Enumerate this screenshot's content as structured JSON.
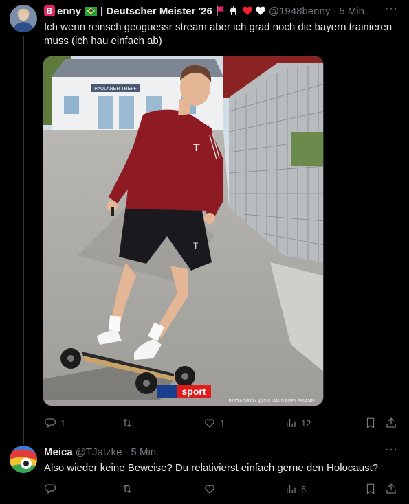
{
  "tweet1": {
    "author_name": "enny",
    "badge_letter": "B",
    "name_suffix": " | Deutscher Meister '26",
    "handle": "@1948benny",
    "time": "5 Min.",
    "text": "Ich wenn reinsch geoguessr stream aber ich grad noch die bayern trainieren muss (ich hau einfach ab)",
    "image_credit": "INSTAGRAM @JULIAN.NAGELSMANN",
    "broadcaster_logo": "sport",
    "jersey_logo": "T",
    "sign_text": "PAULANER TREFF",
    "stats": {
      "replies": "1",
      "retweets": "",
      "likes": "1",
      "views": "12"
    }
  },
  "tweet2": {
    "author_name": "Meica",
    "handle": "@TJatzke",
    "time": "5 Min.",
    "text": "Also wieder keine Beweise? Du relativierst einfach gerne den Holocaust?",
    "stats": {
      "replies": "",
      "retweets": "",
      "likes": "",
      "views": "6"
    }
  },
  "common": {
    "separator": "·",
    "more": "···"
  },
  "colors": {
    "background": "#000000",
    "text": "#e7e9ea",
    "muted": "#71767b",
    "border": "#2f3336",
    "badge": "#e0245e"
  }
}
